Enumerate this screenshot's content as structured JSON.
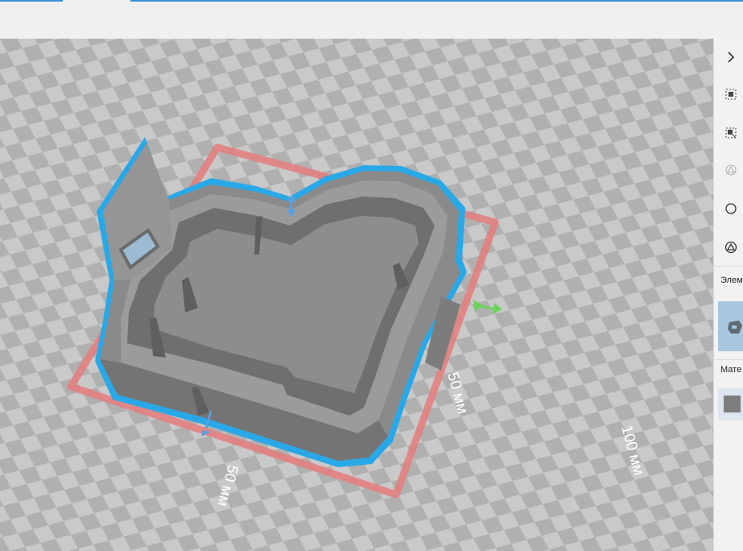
{
  "viewport": {
    "dimension_labels": {
      "object_depth": "50 мм",
      "object_width": "50 мм",
      "plate_depth": "100 мм"
    }
  },
  "panel": {
    "collapse_icon": "chevron-right-icon",
    "tools": [
      {
        "name": "select-all-icon",
        "enabled": true
      },
      {
        "name": "deselect-icon",
        "enabled": true
      },
      {
        "name": "reset-orientation-icon",
        "enabled": false
      },
      {
        "name": "circle-icon",
        "enabled": true
      },
      {
        "name": "triangle-in-circle-icon",
        "enabled": true
      }
    ],
    "elements_label": "Элем",
    "material_label": "Мате",
    "material_color": "#7e7e7e"
  },
  "colors": {
    "selection_outline": "#29a8e8",
    "bounding_box": "#e27f7f",
    "model_gray": "#8a8a8a",
    "grid_light": "#c9c9c9",
    "grid_dark": "#b0b0b0",
    "axis_y": "#5b9fd8",
    "axis_x": "#6cd45a"
  }
}
